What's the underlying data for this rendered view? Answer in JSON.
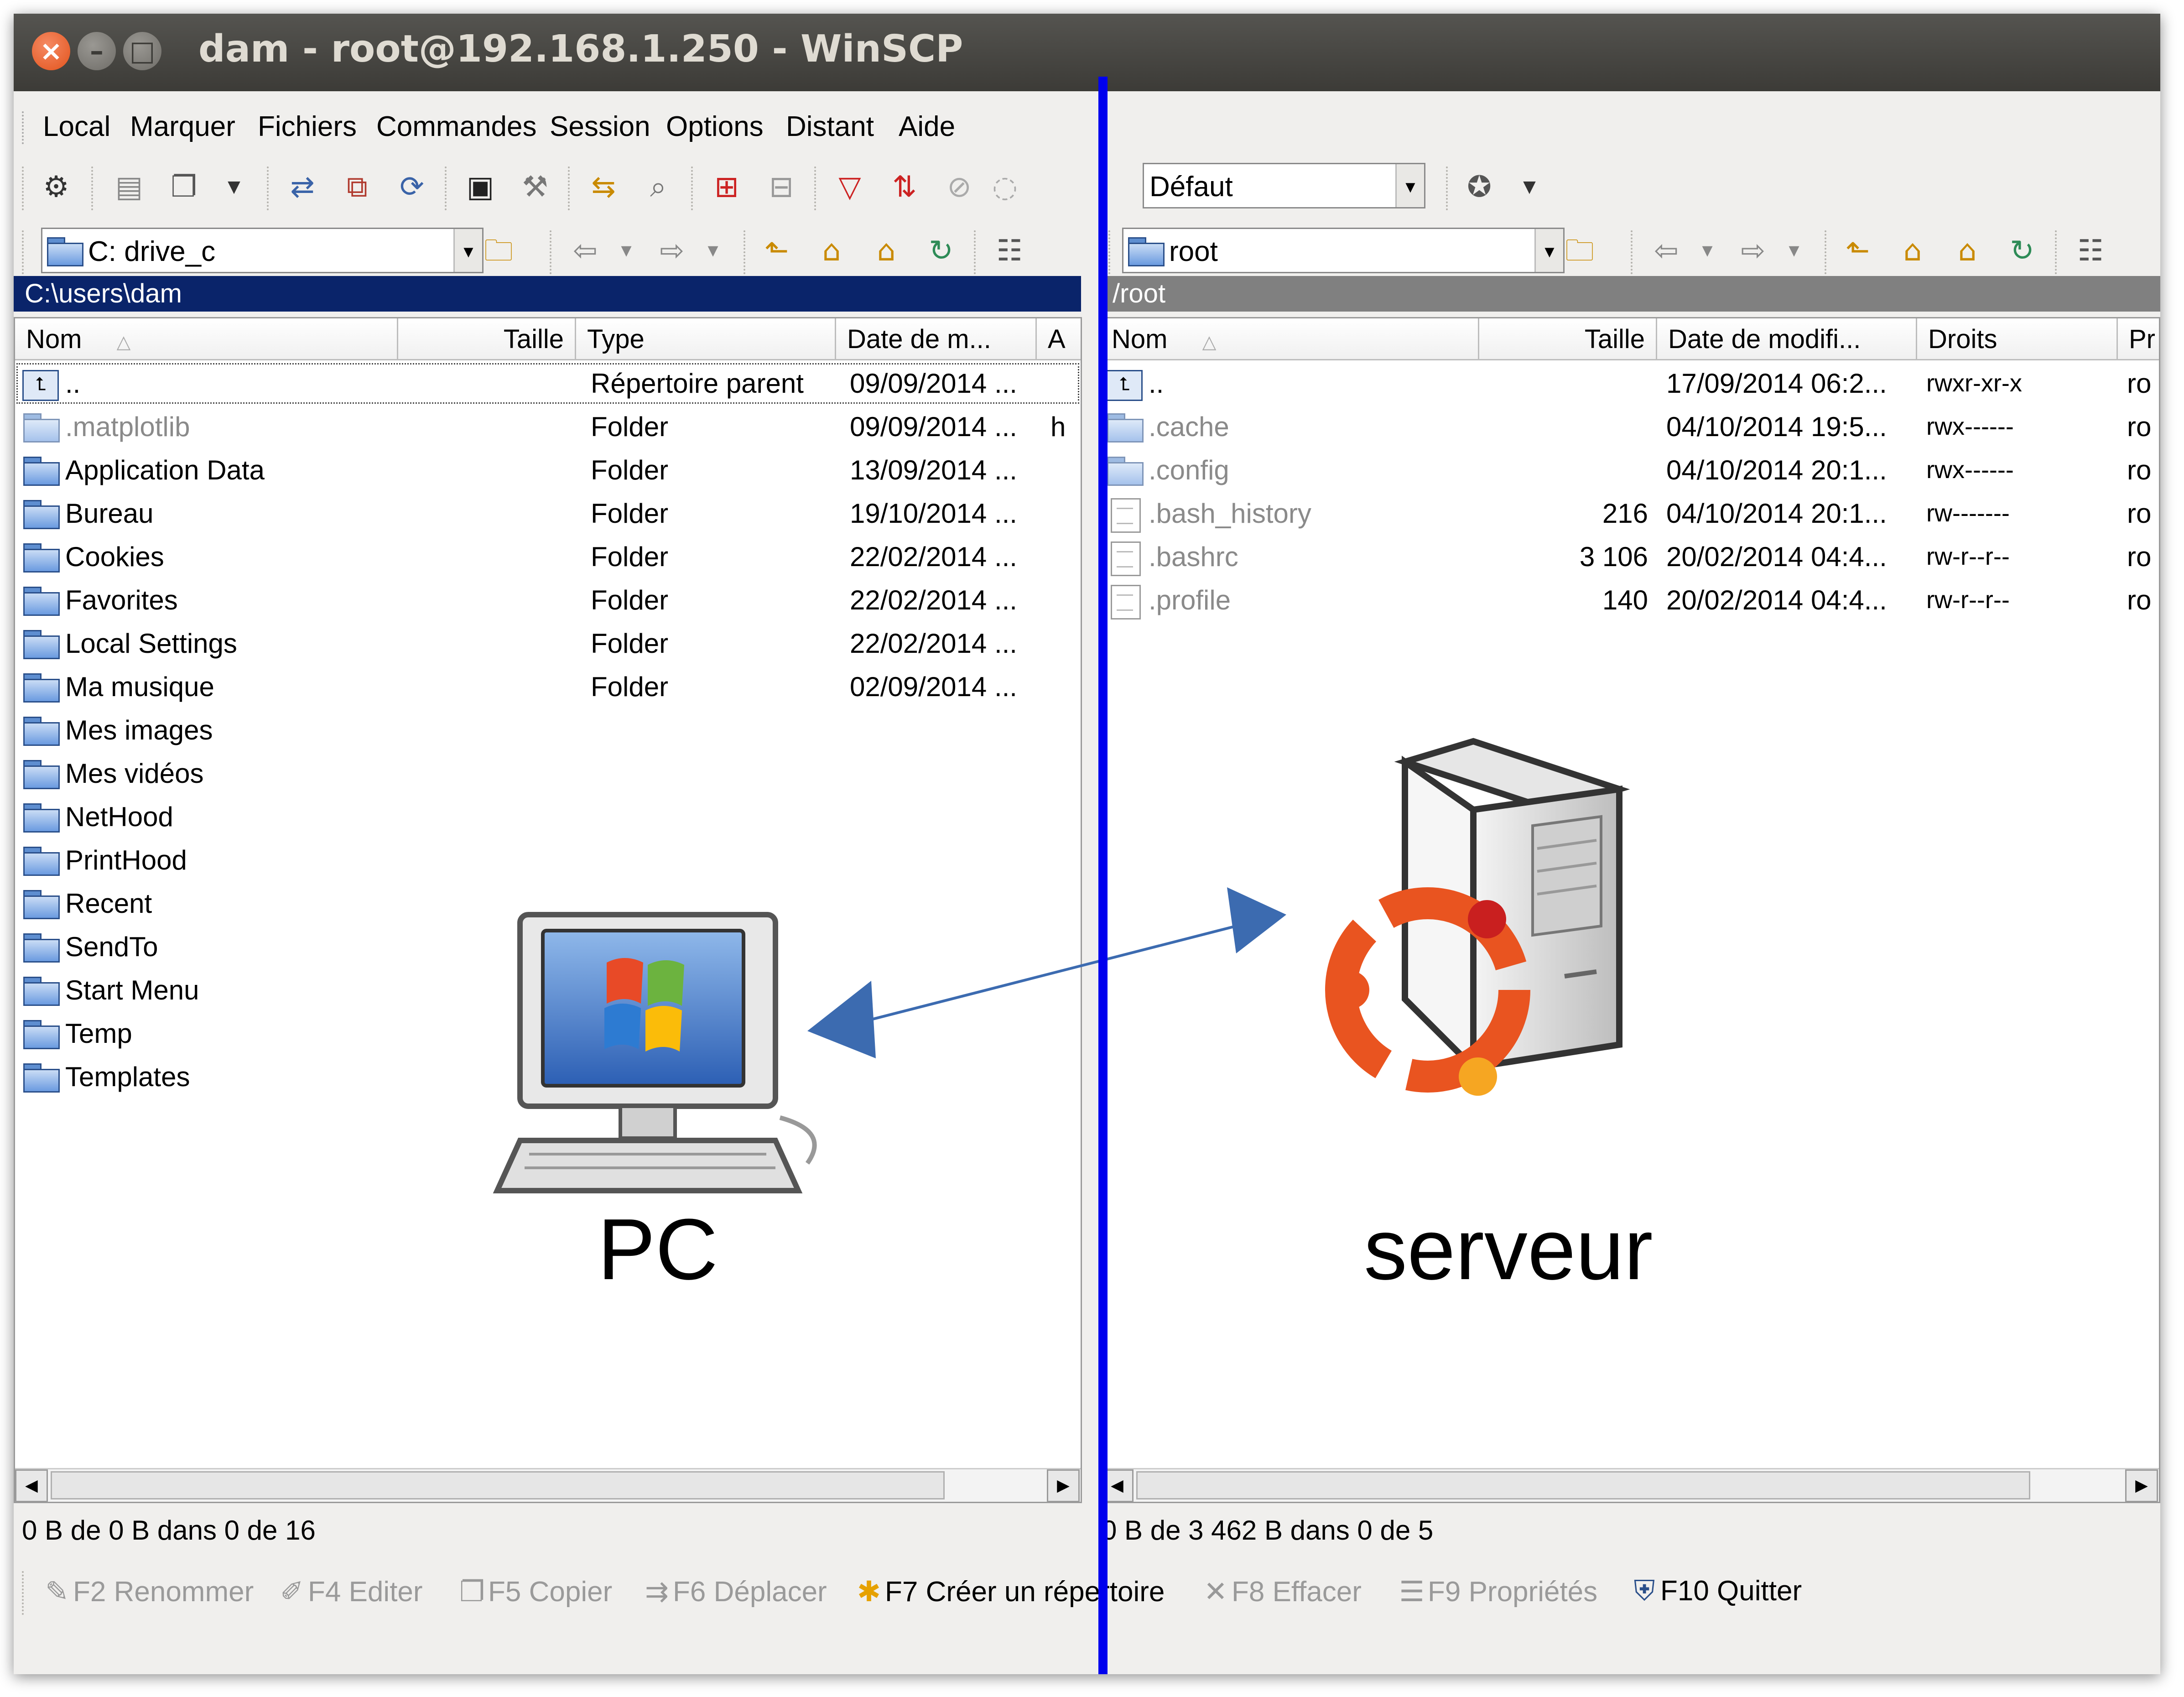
{
  "window": {
    "title": "dam - root@192.168.1.250 - WinSCP"
  },
  "menu": [
    "Local",
    "Marquer",
    "Fichiers",
    "Commandes",
    "Session",
    "Options",
    "Distant",
    "Aide"
  ],
  "toolbar": {
    "profile_select": "Défaut"
  },
  "left": {
    "drive_select": "C: drive_c",
    "path": "C:\\users\\dam",
    "columns": [
      "Nom",
      "Taille",
      "Type",
      "Date de m...",
      "A"
    ],
    "rows": [
      {
        "name": "..",
        "type": "Répertoire parent",
        "date": "09/09/2014 ...",
        "attr": ""
      },
      {
        "name": ".matplotlib",
        "type": "Folder",
        "date": "09/09/2014 ...",
        "attr": "h"
      },
      {
        "name": "Application Data",
        "type": "Folder",
        "date": "13/09/2014 ...",
        "attr": ""
      },
      {
        "name": "Bureau",
        "type": "Folder",
        "date": "19/10/2014 ...",
        "attr": ""
      },
      {
        "name": "Cookies",
        "type": "Folder",
        "date": "22/02/2014 ...",
        "attr": ""
      },
      {
        "name": "Favorites",
        "type": "Folder",
        "date": "22/02/2014 ...",
        "attr": ""
      },
      {
        "name": "Local Settings",
        "type": "Folder",
        "date": "22/02/2014 ...",
        "attr": ""
      },
      {
        "name": "Ma musique",
        "type": "Folder",
        "date": "02/09/2014 ...",
        "attr": ""
      },
      {
        "name": "Mes images",
        "type": "",
        "date": "",
        "attr": ""
      },
      {
        "name": "Mes vidéos",
        "type": "",
        "date": "",
        "attr": ""
      },
      {
        "name": "NetHood",
        "type": "",
        "date": "",
        "attr": ""
      },
      {
        "name": "PrintHood",
        "type": "",
        "date": "",
        "attr": ""
      },
      {
        "name": "Recent",
        "type": "",
        "date": "",
        "attr": ""
      },
      {
        "name": "SendTo",
        "type": "",
        "date": "",
        "attr": ""
      },
      {
        "name": "Start Menu",
        "type": "",
        "date": "",
        "attr": ""
      },
      {
        "name": "Temp",
        "type": "",
        "date": "",
        "attr": ""
      },
      {
        "name": "Templates",
        "type": "",
        "date": "",
        "attr": ""
      }
    ],
    "status": "0 B de 0 B dans 0 de 16",
    "overlay_label": "PC"
  },
  "right": {
    "dir_select": "root",
    "path": "/root",
    "columns": [
      "Nom",
      "Taille",
      "Date de modifi...",
      "Droits",
      "Pr"
    ],
    "rows": [
      {
        "name": "..",
        "size": "",
        "date": "17/09/2014 06:2...",
        "rights": "rwxr-xr-x",
        "owner": "ro"
      },
      {
        "name": ".cache",
        "size": "",
        "date": "04/10/2014 19:5...",
        "rights": "rwx------",
        "owner": "ro"
      },
      {
        "name": ".config",
        "size": "",
        "date": "04/10/2014 20:1...",
        "rights": "rwx------",
        "owner": "ro"
      },
      {
        "name": ".bash_history",
        "size": "216",
        "date": "04/10/2014 20:1...",
        "rights": "rw-------",
        "owner": "ro"
      },
      {
        "name": ".bashrc",
        "size": "3 106",
        "date": "20/02/2014 04:4...",
        "rights": "rw-r--r--",
        "owner": "ro"
      },
      {
        "name": ".profile",
        "size": "140",
        "date": "20/02/2014 04:4...",
        "rights": "rw-r--r--",
        "owner": "ro"
      }
    ],
    "status": "0 B de 3 462 B dans 0 de 5",
    "overlay_label": "serveur"
  },
  "fkeys": [
    {
      "label": "F2 Renommer",
      "enabled": false,
      "icon": "rename-icon"
    },
    {
      "label": "F4 Editer",
      "enabled": false,
      "icon": "edit-icon"
    },
    {
      "label": "F5 Copier",
      "enabled": false,
      "icon": "copy-icon"
    },
    {
      "label": "F6 Déplacer",
      "enabled": false,
      "icon": "move-icon"
    },
    {
      "label": "F7 Créer un répertoire",
      "enabled": true,
      "icon": "new-folder-icon"
    },
    {
      "label": "F8 Effacer",
      "enabled": false,
      "icon": "delete-icon"
    },
    {
      "label": "F9 Propriétés",
      "enabled": false,
      "icon": "properties-icon"
    },
    {
      "label": "F10 Quitter",
      "enabled": true,
      "icon": "quit-icon"
    }
  ],
  "colors": {
    "active_path": "#0a246a",
    "inactive_path": "#808080",
    "divider": "#0000ee",
    "arrow": "#3c6bb0"
  }
}
